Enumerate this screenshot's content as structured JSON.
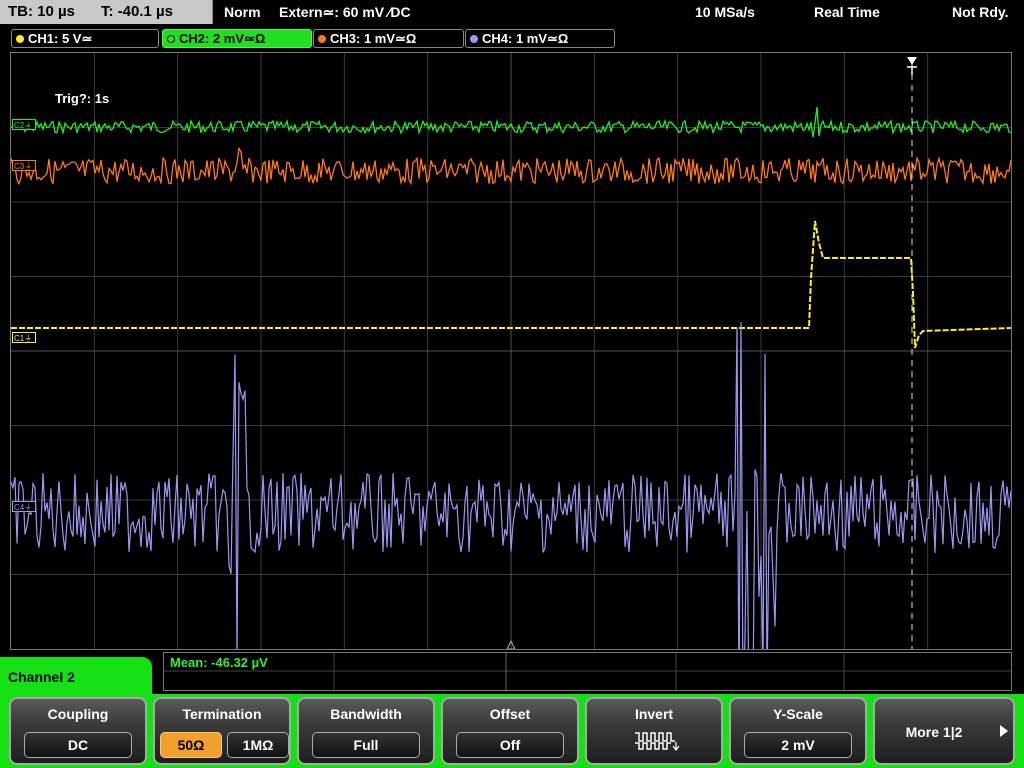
{
  "status": {
    "timebase": "TB: 10 µs",
    "trigger_time": "T: -40.1 µs",
    "mode": "Norm",
    "trigger_source": "Extern≃: 60 mV ∕DC",
    "sample_rate": "10 MSa/s",
    "acq_mode": "Real Time",
    "readiness": "Not Rdy."
  },
  "channels": [
    {
      "label": "CH1: 5 V≃",
      "color": "#ffee22",
      "active": false
    },
    {
      "label": "CH2: 2 mV≃Ω",
      "color": "#22ee22",
      "active": true
    },
    {
      "label": "CH3: 1 mV≃Ω",
      "color": "#ff7a1a",
      "active": false
    },
    {
      "label": "CH4: 1 mV≃Ω",
      "color": "#9a98f0",
      "active": false
    }
  ],
  "plot": {
    "trig_info": "Trig?: 1s",
    "markers": {
      "c1": "C1⏚",
      "c2": "C2⏚",
      "c3": "C3⏚",
      "c4": "C4⏚"
    }
  },
  "measurement": {
    "mean": "Mean: -46.32 µV"
  },
  "channel_panel": {
    "title": "Channel 2"
  },
  "softkeys": {
    "coupling": {
      "title": "Coupling",
      "value": "DC"
    },
    "termination": {
      "title": "Termination",
      "opt1": "50Ω",
      "opt2": "1MΩ"
    },
    "bandwidth": {
      "title": "Bandwidth",
      "value": "Full"
    },
    "offset": {
      "title": "Offset",
      "value": "Off"
    },
    "invert": {
      "title": "Invert"
    },
    "yscale": {
      "title": "Y-Scale",
      "value": "2 mV"
    },
    "more": {
      "label": "More 1|2"
    }
  },
  "colors": {
    "ch1": "#ffee22",
    "ch2": "#22ee22",
    "ch3": "#ff7a1a",
    "ch4": "#9a98f0",
    "accent": "#14e014"
  }
}
